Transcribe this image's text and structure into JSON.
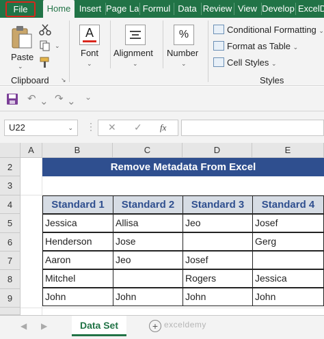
{
  "ribbon_tabs": [
    "File",
    "Home",
    "Insert",
    "Page La",
    "Formul",
    "Data",
    "Review",
    "View",
    "Develop",
    "ExcelD"
  ],
  "groups": {
    "clipboard": {
      "label": "Clipboard",
      "paste_label": "Paste"
    },
    "font": {
      "label": "Font",
      "icon_glyph": "A"
    },
    "alignment": {
      "label": "Alignment"
    },
    "number": {
      "label": "Number",
      "icon_glyph": "%"
    },
    "styles": {
      "label": "Styles",
      "conditional": "Conditional Formatting",
      "format_table": "Format as Table",
      "cell_styles": "Cell Styles"
    }
  },
  "formula_bar": {
    "name_box": "U22",
    "fx": "fx",
    "value": ""
  },
  "columns": [
    "A",
    "B",
    "C",
    "D",
    "E"
  ],
  "rows": [
    "2",
    "3",
    "4",
    "5",
    "6",
    "7",
    "8",
    "9"
  ],
  "sheet": {
    "title": "Remove Metadata From Excel",
    "headers": [
      "Standard 1",
      "Standard 2",
      "Standard 3",
      "Standard 4"
    ],
    "data": [
      [
        "Jessica",
        "Allisa",
        "Jeo",
        "Josef"
      ],
      [
        "Henderson",
        "Jose",
        "",
        "Gerg"
      ],
      [
        "Aaron",
        "Jeo",
        "Josef",
        ""
      ],
      [
        "Mitchel",
        "",
        "Rogers",
        "Jessica"
      ],
      [
        "John",
        "John",
        "John",
        "John"
      ]
    ]
  },
  "sheet_tabs": {
    "active": "Data Set",
    "add": "+",
    "watermark": "exceldemy"
  },
  "colors": {
    "excel_green": "#217346",
    "title_bg": "#2f4f8f",
    "header_bg": "#d6dce4",
    "file_highlight": "#d9261c"
  }
}
